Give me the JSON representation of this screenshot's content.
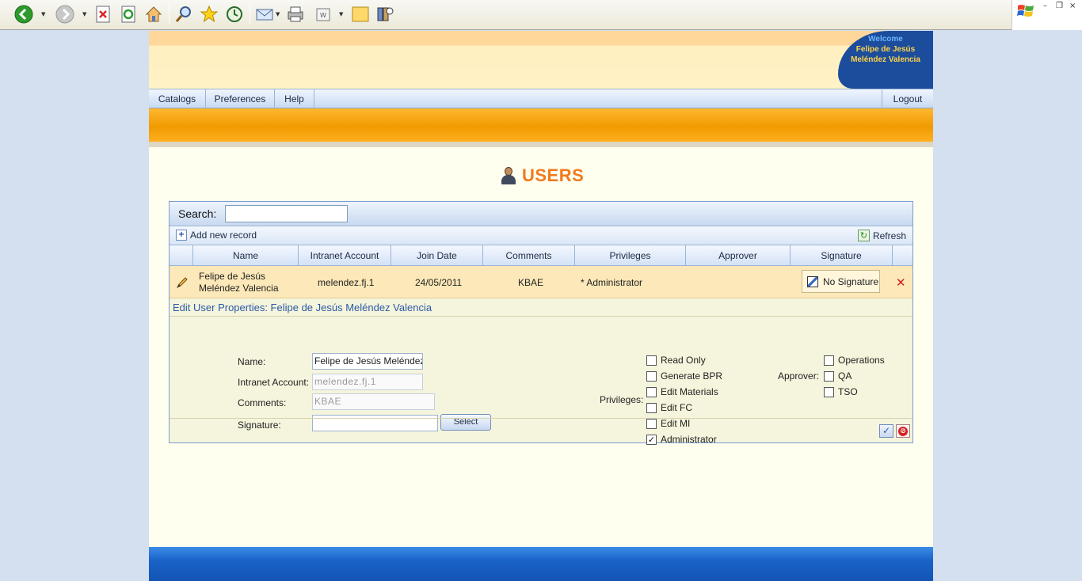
{
  "browser": {
    "toolbar_icons": [
      "back-icon",
      "forward-icon",
      "stop-icon",
      "refresh-icon",
      "home-icon",
      "search-icon",
      "favorites-icon",
      "history-icon",
      "mail-icon",
      "print-icon",
      "edit-icon",
      "discuss-icon",
      "research-icon"
    ]
  },
  "header": {
    "welcome_label": "Welcome",
    "user_name_line1": "Felipe de Jesús",
    "user_name_line2": "Meléndez Valencia"
  },
  "menu": {
    "items": [
      {
        "label": "Catalogs"
      },
      {
        "label": "Preferences"
      },
      {
        "label": "Help"
      }
    ],
    "logout_label": "Logout"
  },
  "page": {
    "title": "USERS"
  },
  "grid": {
    "search_label": "Search:",
    "search_value": "",
    "add_label": "Add new record",
    "refresh_label": "Refresh",
    "columns": [
      "Name",
      "Intranet Account",
      "Join Date",
      "Comments",
      "Privileges",
      "Approver",
      "Signature"
    ],
    "row": {
      "name_line1": "Felipe de Jesús",
      "name_line2": "Meléndez Valencia",
      "intranet_account": "melendez.fj.1",
      "join_date": "24/05/2011",
      "comments": "KBAE",
      "privileges": "* Administrator",
      "approver": "",
      "signature": "No Signature"
    }
  },
  "edit": {
    "title": "Edit User Properties: Felipe de Jesús Meléndez Valencia",
    "name_label": "Name:",
    "name_value": "Felipe de Jesús Meléndez V",
    "intranet_label": "Intranet Account:",
    "intranet_value": "melendez.fj.1",
    "comments_label": "Comments:",
    "comments_value": "KBAE",
    "signature_label": "Signature:",
    "signature_value": "",
    "select_label": "Select",
    "privileges_label": "Privileges:",
    "privileges": [
      {
        "label": "Read Only",
        "checked": false
      },
      {
        "label": "Generate BPR",
        "checked": false
      },
      {
        "label": "Edit Materials",
        "checked": false
      },
      {
        "label": "Edit FC",
        "checked": false
      },
      {
        "label": "Edit MI",
        "checked": false
      },
      {
        "label": "Administrator",
        "checked": true
      }
    ],
    "approver_label": "Approver:",
    "approvers": [
      {
        "label": "Operations",
        "checked": false
      },
      {
        "label": "QA",
        "checked": false
      },
      {
        "label": "TSO",
        "checked": false
      }
    ]
  }
}
